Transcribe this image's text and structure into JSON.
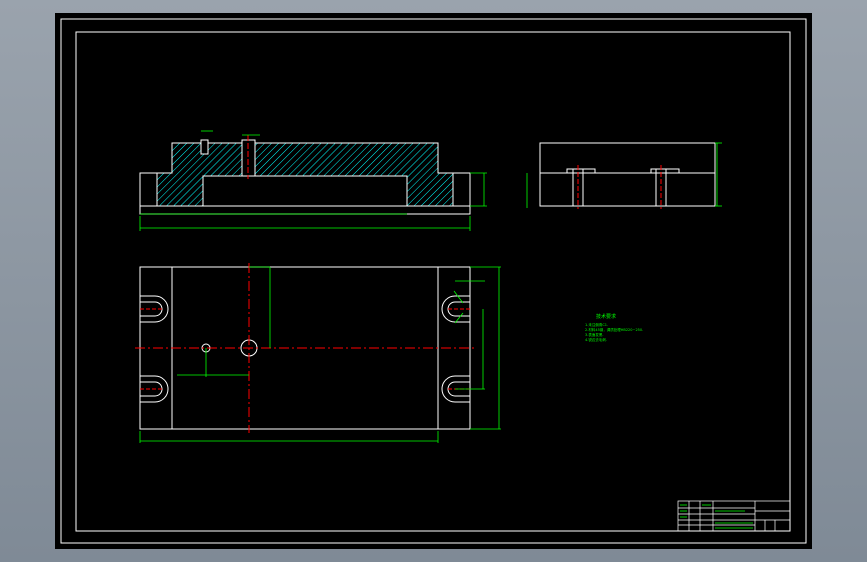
{
  "drawing": {
    "colors": {
      "background": "#000000",
      "frame": "#ffffff",
      "outline": "#ffffff",
      "hatch": "#00ffff",
      "dimension": "#00ff00",
      "centerline": "#ff0000"
    },
    "icons": {
      "u_slot": "u-slot-icon",
      "bolt_hole": "hole-icon"
    }
  },
  "notes": {
    "title": "技术要求",
    "lines": [
      "1.未注倒角C1.",
      "2.材料45钢，调质处理HB220~250.",
      "3.表面发黑.",
      "4.锐边去毛刺."
    ]
  }
}
